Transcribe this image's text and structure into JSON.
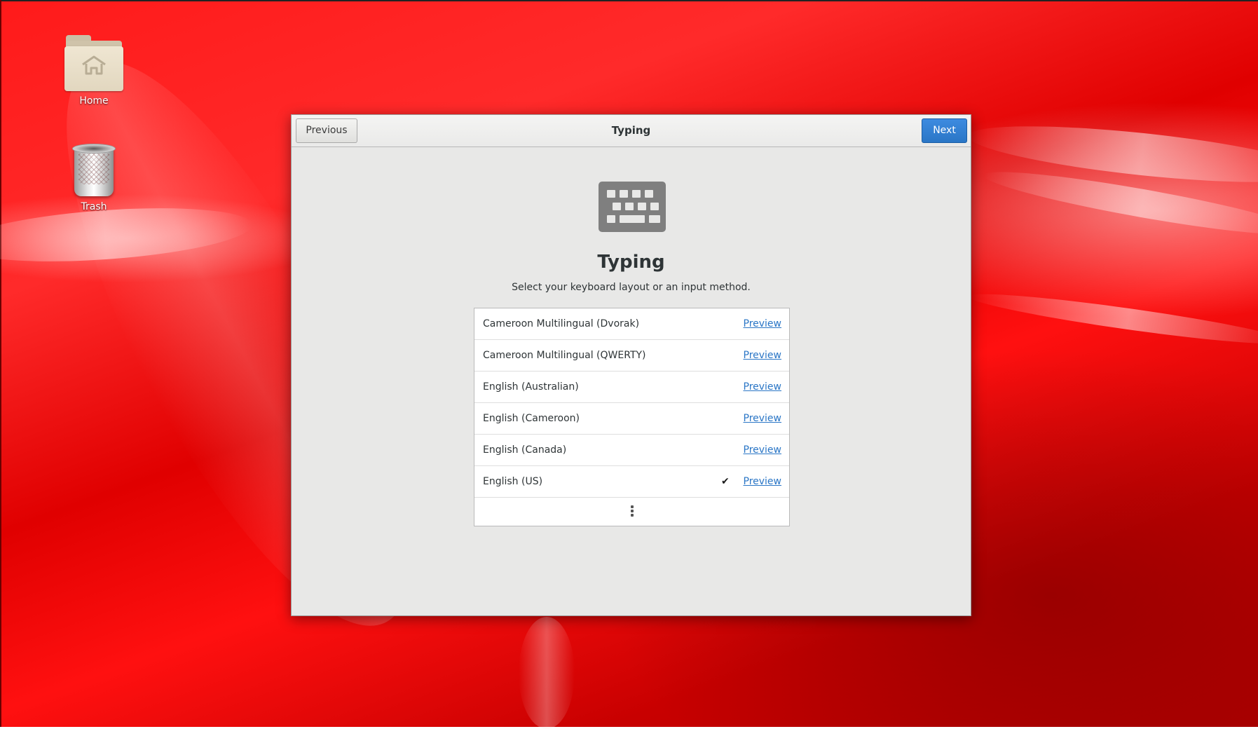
{
  "desktop": {
    "icons": [
      {
        "label": "Home",
        "icon": "home-folder-icon"
      },
      {
        "label": "Trash",
        "icon": "trash-icon"
      }
    ],
    "colors": {
      "background": "#e00000"
    }
  },
  "dialog": {
    "header": {
      "previous_label": "Previous",
      "title": "Typing",
      "next_label": "Next",
      "next_color": "#2a76c6"
    },
    "icon": "keyboard-icon",
    "title": "Typing",
    "subtitle": "Select your keyboard layout or an input method.",
    "layouts": [
      {
        "name": "Cameroon Multilingual (Dvorak)",
        "preview": "Preview",
        "selected": false
      },
      {
        "name": "Cameroon Multilingual (QWERTY)",
        "preview": "Preview",
        "selected": false
      },
      {
        "name": "English (Australian)",
        "preview": "Preview",
        "selected": false
      },
      {
        "name": "English (Cameroon)",
        "preview": "Preview",
        "selected": false
      },
      {
        "name": "English (Canada)",
        "preview": "Preview",
        "selected": false
      },
      {
        "name": "English (US)",
        "preview": "Preview",
        "selected": true,
        "check": "✔"
      }
    ],
    "more_icon": "more-vertical-icon"
  }
}
